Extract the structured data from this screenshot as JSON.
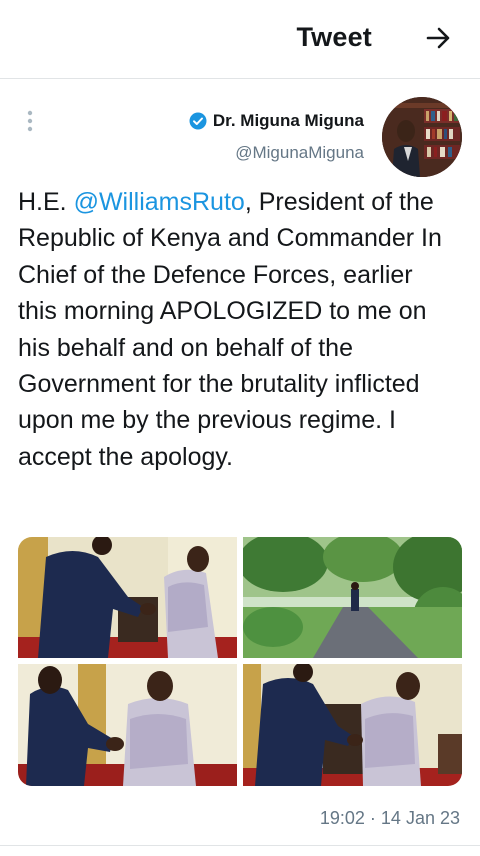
{
  "header": {
    "title": "Tweet"
  },
  "author": {
    "display_name": "Dr. Miguna Miguna",
    "handle": "@MigunaMiguna",
    "verified": true
  },
  "tweet": {
    "text_before": "H.E. ",
    "mention": "@WilliamsRuto",
    "text_after": ", President of the Republic of Kenya and Commander In Chief of the Defence Forces, earlier this morning APOLOGIZED to me on his behalf and on behalf of the Government for the brutality inflicted upon me by the previous regime. I accept the apology."
  },
  "photos_count": 4,
  "meta": {
    "time": "19:02",
    "separator": "·",
    "date": "14 Jan 23"
  },
  "colors": {
    "accent": "#1b95e0",
    "secondary_text": "#657786",
    "divider": "#e1e4e6"
  },
  "icons": [
    "arrow-right-icon",
    "more-vertical-icon",
    "verified-badge-icon"
  ]
}
